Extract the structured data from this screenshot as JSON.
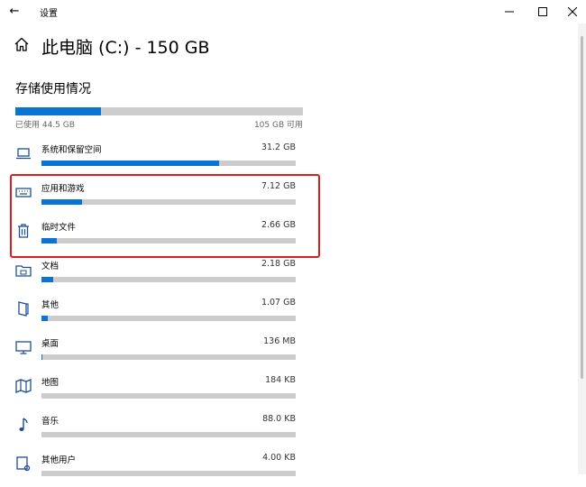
{
  "window": {
    "title": "设置",
    "back_glyph": "←",
    "controls": [
      "minimize",
      "maximize",
      "close"
    ]
  },
  "header": {
    "title": "此电脑 (C:) - 150 GB",
    "icon": "home-icon"
  },
  "storage": {
    "heading": "存储使用情况",
    "used_label": "已使用 44.5 GB",
    "available_label": "105 GB 可用",
    "used_fraction": 0.297
  },
  "categories": [
    {
      "name": "系统和保留空间",
      "size": "31.2 GB",
      "icon": "laptop-icon",
      "fraction": 0.7
    },
    {
      "name": "应用和游戏",
      "size": "7.12 GB",
      "icon": "keyboard-icon",
      "fraction": 0.16
    },
    {
      "name": "临时文件",
      "size": "2.66 GB",
      "icon": "trash-icon",
      "fraction": 0.06
    },
    {
      "name": "文档",
      "size": "2.18 GB",
      "icon": "folder-icon",
      "fraction": 0.045
    },
    {
      "name": "其他",
      "size": "1.07 GB",
      "icon": "document-icon",
      "fraction": 0.025
    },
    {
      "name": "桌面",
      "size": "136 MB",
      "icon": "monitor-icon",
      "fraction": 0.004
    },
    {
      "name": "地图",
      "size": "184 KB",
      "icon": "map-icon",
      "fraction": 0.0
    },
    {
      "name": "音乐",
      "size": "88.0 KB",
      "icon": "music-icon",
      "fraction": 0.0
    },
    {
      "name": "其他用户",
      "size": "4.00 KB",
      "icon": "users-icon",
      "fraction": 0.0
    }
  ],
  "colors": {
    "accent": "#0a74d4",
    "track": "#cccccc",
    "highlight": "#e21b1b"
  }
}
